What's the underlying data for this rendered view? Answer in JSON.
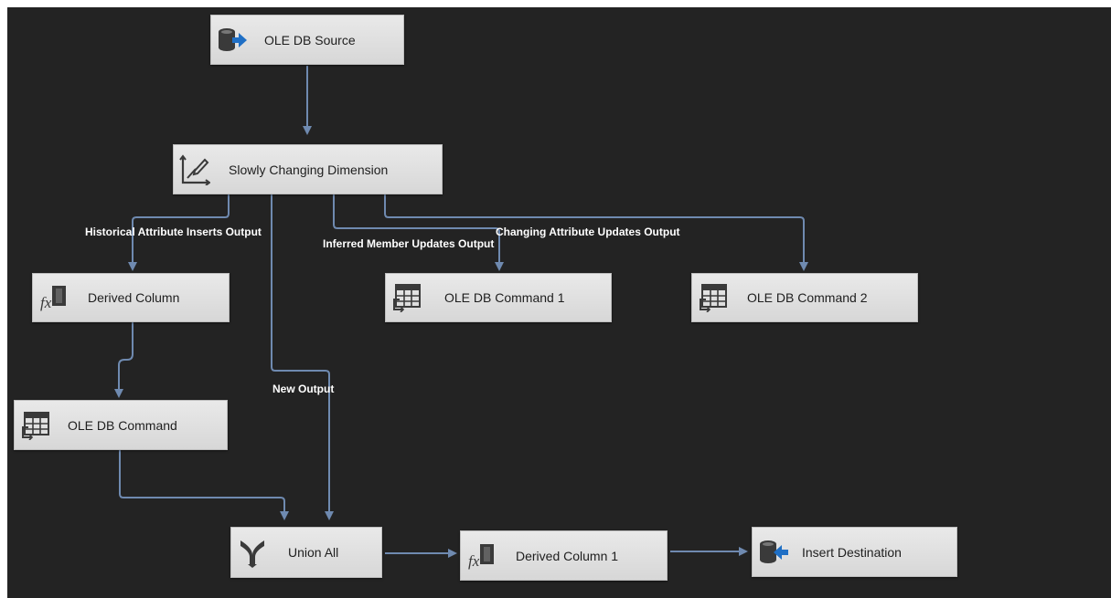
{
  "components": {
    "ole_db_source": {
      "label": "OLE DB Source",
      "icon": "ole-db-source-icon"
    },
    "scd": {
      "label": "Slowly Changing Dimension",
      "icon": "slowly-changing-dimension-icon"
    },
    "derived_column": {
      "label": "Derived Column",
      "icon": "derived-column-icon"
    },
    "ole_db_command_1": {
      "label": "OLE DB Command 1",
      "icon": "ole-db-command-icon"
    },
    "ole_db_command_2": {
      "label": "OLE DB Command 2",
      "icon": "ole-db-command-icon"
    },
    "ole_db_command": {
      "label": "OLE DB Command",
      "icon": "ole-db-command-icon"
    },
    "union_all": {
      "label": "Union All",
      "icon": "union-all-icon"
    },
    "derived_column_1": {
      "label": "Derived Column 1",
      "icon": "derived-column-icon"
    },
    "insert_destination": {
      "label": "Insert Destination",
      "icon": "ole-db-destination-icon"
    }
  },
  "path_labels": {
    "historical": "Historical Attribute Inserts Output",
    "inferred": "Inferred Member Updates Output",
    "changing": "Changing Attribute Updates Output",
    "new_output": "New Output"
  },
  "colors": {
    "canvas": "#232323",
    "connector": "#6f8ab0",
    "node_fill": "#e0e0e0",
    "label_text": "#ffffff"
  }
}
